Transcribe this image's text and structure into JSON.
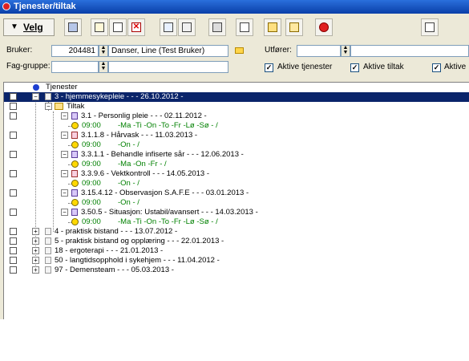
{
  "window": {
    "title": "Tjenester/tiltak"
  },
  "toolbar": {
    "velg_label": "Velg",
    "buttons": [
      "exit-icon",
      "new-icon",
      "edit-icon",
      "delete-icon",
      "list-icon",
      "sort-icon",
      "print-icon",
      "copy-icon",
      "report-icon",
      "export-icon",
      "stop-icon",
      "clipboard-icon"
    ]
  },
  "bruker": {
    "label": "Bruker:",
    "id": "204481",
    "name": "Danser, Line (Test Bruker)"
  },
  "faggruppe": {
    "label": "Fag-gruppe:",
    "value": ""
  },
  "utforer": {
    "label": "Utfører:",
    "value": ""
  },
  "filters": [
    {
      "label": "Aktive tjenester",
      "checked": true
    },
    {
      "label": "Aktive tiltak",
      "checked": true
    },
    {
      "label": "Aktive",
      "checked": true
    }
  ],
  "tree": {
    "root": "Tjenester",
    "main_service": "3 - hjemmesykepleie - - - 26.10.2012 -",
    "tiltak_label": "Tiltak",
    "measures": [
      {
        "title": "3.1 - Personlig pleie - - - 02.11.2012 -",
        "time": "09:00",
        "days": "-Ma -Ti -On -To -Fr -Lø -Sø - /"
      },
      {
        "title": "3.1.1.8 - Hårvask - - - 11.03.2013 -",
        "time": "09:00",
        "days": "-On - /"
      },
      {
        "title": "3.3.1.1 - Behandle infiserte sår - - - 12.06.2013 -",
        "time": "09:00",
        "days": "-Ma -On -Fr - /"
      },
      {
        "title": "3.3.9.6 - Vektkontroll - - - 14.05.2013 -",
        "time": "09:00",
        "days": "-On - /"
      },
      {
        "title": "3.15.4.12 - Observasjon S.A.F.E - - - 03.01.2013 -",
        "time": "09:00",
        "days": "-On - /"
      },
      {
        "title": "3.50.5 - Situasjon: Ustabil/avansert - - - 14.03.2013 -",
        "time": "09:00",
        "days": "-Ma -Ti -On -To -Fr -Lø -Sø - /"
      }
    ],
    "other_services": [
      "4 - praktisk bistand - - - 13.07.2012 -",
      "5 - praktisk bistand og opplæring - - - 22.01.2013 -",
      "18 - ergoterapi - - - 21.01.2013 -",
      "50 - langtidsopphold i sykehjem - - - 11.04.2012 -",
      "97 - Demensteam - - - 05.03.2013 -"
    ]
  }
}
